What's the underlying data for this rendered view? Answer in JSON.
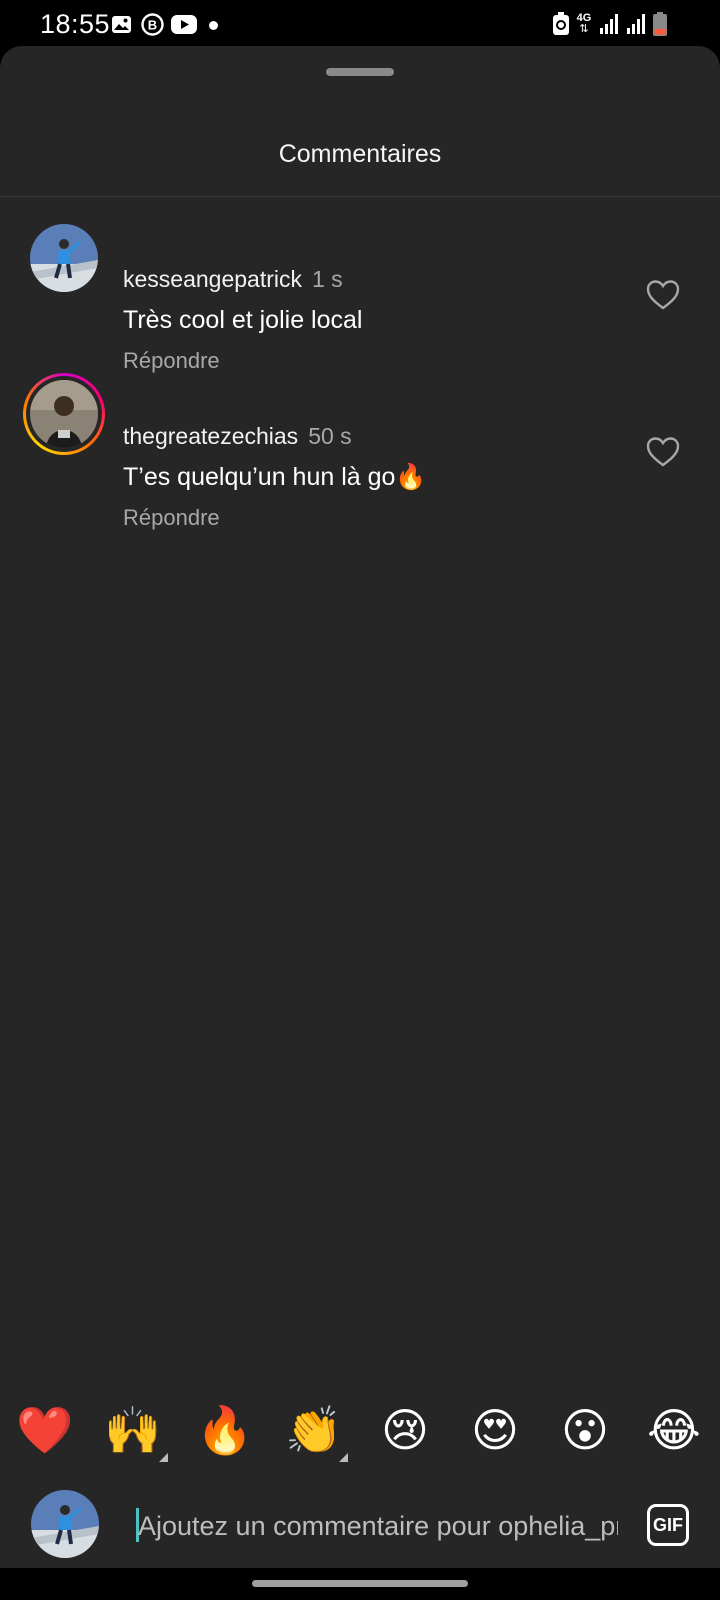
{
  "status_bar": {
    "time": "18:55",
    "icons": [
      "gallery-icon",
      "b-circle-icon",
      "youtube-icon",
      "notification-dot-icon",
      "recycle-icon",
      "4g-icon",
      "signal-icon",
      "signal-icon",
      "battery-low-icon"
    ],
    "network_label": "4G"
  },
  "sheet": {
    "title": "Commentaires"
  },
  "comments": [
    {
      "username": "kesseangepatrick",
      "time": "1 s",
      "text": "Très cool et jolie local",
      "reply_label": "Répondre",
      "has_story_ring": false
    },
    {
      "username": "thegreatezechias",
      "time": "50 s",
      "text": "T’es quelqu’un hun là go🔥",
      "reply_label": "Répondre",
      "has_story_ring": true
    }
  ],
  "emoji_bar": [
    "❤️",
    "🙌",
    "🔥",
    "👏",
    "😢",
    "😍",
    "😮",
    "😂"
  ],
  "composer": {
    "placeholder": "Ajoutez un commentaire pour ophelia_pri",
    "gif_label": "GIF"
  },
  "colors": {
    "sheet_bg": "#262626",
    "status_bg": "#000000",
    "secondary_text": "#a8a8a8",
    "caret": "#4ec1c1"
  }
}
